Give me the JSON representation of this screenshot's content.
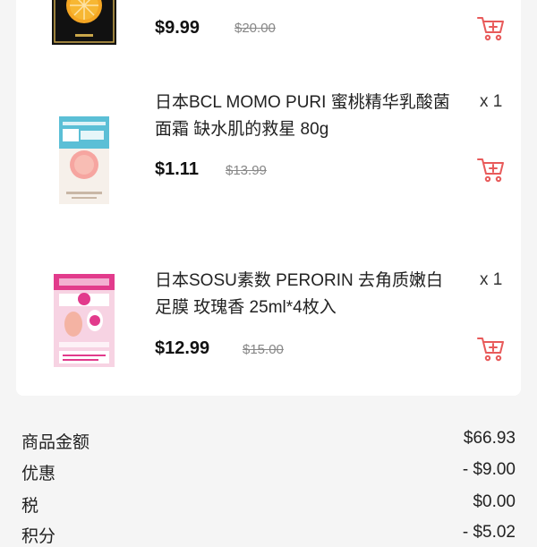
{
  "items": [
    {
      "title": "",
      "quantity": "",
      "price": "$9.99",
      "original_price": "$20.00"
    },
    {
      "title": "日本BCL MOMO PURI 蜜桃精华乳酸菌面霜 缺水肌的救星 80g",
      "quantity": "x 1",
      "price": "$1.11",
      "original_price": "$13.99"
    },
    {
      "title": "日本SOSU素数 PERORIN 去角质嫩白足膜 玫瑰香 25ml*4枚入",
      "quantity": "x 1",
      "price": "$12.99",
      "original_price": "$15.00"
    }
  ],
  "summary": [
    {
      "label": "商品金额",
      "value": "$66.93"
    },
    {
      "label": "优惠",
      "value": "- $9.00"
    },
    {
      "label": "税",
      "value": "$0.00"
    },
    {
      "label": "积分",
      "value": "- $5.02"
    }
  ],
  "colors": {
    "cart_icon": "#e85a5a",
    "background": "#f5f5f5",
    "card": "#ffffff"
  },
  "icons": {
    "cart": "add-to-cart-icon"
  }
}
